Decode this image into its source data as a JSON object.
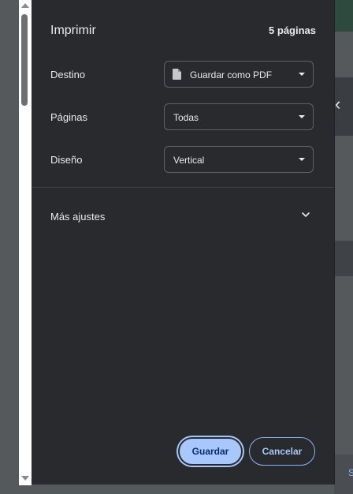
{
  "dialog": {
    "title": "Imprimir",
    "page_count": "5 páginas",
    "destination": {
      "label": "Destino",
      "value": "Guardar como PDF",
      "icon": "document-icon"
    },
    "pages": {
      "label": "Páginas",
      "value": "Todas"
    },
    "layout": {
      "label": "Diseño",
      "value": "Vertical"
    },
    "more_settings": {
      "label": "Más ajustes",
      "icon": "chevron-down-icon"
    },
    "buttons": {
      "save": "Guardar",
      "cancel": "Cancelar"
    }
  },
  "background": {
    "edge_letter": "S"
  },
  "colors": {
    "panel": "#292a2d",
    "text": "#e8eaed",
    "accent": "#a8c7fa",
    "border": "#5f6368"
  }
}
